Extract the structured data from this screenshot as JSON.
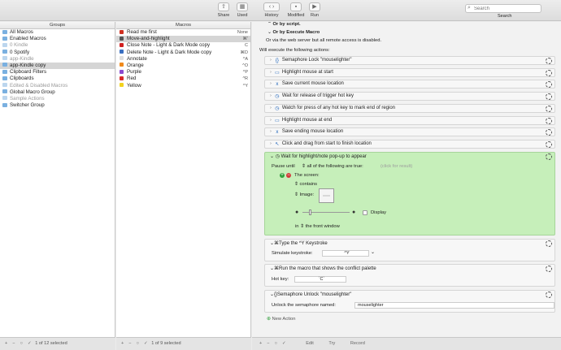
{
  "toolbar": {
    "share": "Share",
    "used": "Used",
    "history": "History",
    "modified": "Modified",
    "run": "Run",
    "search_placeholder": "Search",
    "search_label": "Search"
  },
  "groups": {
    "header": "Groups",
    "items": [
      {
        "label": "All Macros",
        "dim": false,
        "sel": false
      },
      {
        "label": "Enabled Macros",
        "dim": false,
        "sel": false
      },
      {
        "label": "0 Kindle",
        "dim": true,
        "sel": false
      },
      {
        "label": "0 Spotify",
        "dim": false,
        "sel": false
      },
      {
        "label": "app-Kindle",
        "dim": true,
        "sel": false
      },
      {
        "label": "app-Kindle copy",
        "dim": false,
        "sel": true
      },
      {
        "label": "Clipboard Filters",
        "dim": false,
        "sel": false
      },
      {
        "label": "Clipboards",
        "dim": false,
        "sel": false
      },
      {
        "label": "Edited & Disabled Macros",
        "dim": true,
        "sel": false
      },
      {
        "label": "Global Macro Group",
        "dim": false,
        "sel": false
      },
      {
        "label": "Sample Actions",
        "dim": true,
        "sel": false
      },
      {
        "label": "Switcher Group",
        "dim": false,
        "sel": false
      }
    ],
    "footer": "1 of 12 selected"
  },
  "macros": {
    "header": "Macros",
    "items": [
      {
        "label": "Read me first",
        "hotkey": "None",
        "color": "#d03020",
        "sel": false
      },
      {
        "label": "Move-and-highlight",
        "hotkey": "⌘'",
        "color": "#555555",
        "sel": true
      },
      {
        "label": "Close Note - Light & Dark Mode copy",
        "hotkey": "C",
        "color": "#d02020",
        "sel": false
      },
      {
        "label": "Delete Note - Light & Dark Mode copy",
        "hotkey": "⌘D",
        "color": "#3a6fc0",
        "sel": false
      },
      {
        "label": "Annotate",
        "hotkey": "^A",
        "color": "#dddddd",
        "sel": false
      },
      {
        "label": "Orange",
        "hotkey": "^O",
        "color": "#f08a1c",
        "sel": false
      },
      {
        "label": "Purple",
        "hotkey": "^P",
        "color": "#8a4ad0",
        "sel": false
      },
      {
        "label": "Red",
        "hotkey": "^R",
        "color": "#d82a2a",
        "sel": false
      },
      {
        "label": "Yellow",
        "hotkey": "^Y",
        "color": "#f2d21e",
        "sel": false
      }
    ],
    "footer": "1 of 9 selected"
  },
  "editor": {
    "or_script": "Or by script.",
    "or_execute": "Or by Execute Macro",
    "web_server": "Or via the web server but all remote access is disabled.",
    "will_execute": "Will execute the following actions:",
    "actions": [
      {
        "label": "Semaphore Lock \"mouselighter\"",
        "icon": "{}"
      },
      {
        "label": "Highlight mouse at start",
        "icon": "▭"
      },
      {
        "label": "Save current mouse location",
        "icon": "x"
      },
      {
        "label": "Wait for release of trigger hot key",
        "icon": "◷"
      },
      {
        "label": "Watch for press of any hot key to mark end of region",
        "icon": "◷"
      },
      {
        "label": "Highlight mouse at end",
        "icon": "▭"
      },
      {
        "label": "Save ending mouse location",
        "icon": "x"
      },
      {
        "label": "Click and drag from start to finish location",
        "icon": "↖"
      }
    ],
    "wait_action": {
      "label": "Wait for highlight/note pop-up to appear",
      "pause_until": "Pause until",
      "condition_mode": "all of the following are true:",
      "click_result": "(click for result)",
      "screen": "The screen:",
      "contains": "contains",
      "image": "Image:",
      "display": "Display",
      "in_window": "in",
      "front_window": "the front window"
    },
    "type_action": {
      "label": "Type the ^Y Keystroke",
      "simulate": "Simulate keystroke:",
      "keystroke": "^Y"
    },
    "run_action": {
      "label": "Run the macro that shows the conflict palette",
      "hotkey_label": "Hot key:",
      "hotkey": "`C`"
    },
    "unlock_action": {
      "label": "Semaphore Unlock \"mouselighter\"",
      "unlock_named": "Unlock the semaphore named:",
      "name": "mouselighter"
    },
    "new_action": "New Action"
  },
  "bottom": {
    "edit": "Edit",
    "try": "Try",
    "record": "Record"
  },
  "colors": {
    "accent": "#2f7dd8",
    "wait_bg": "#c6efba"
  }
}
